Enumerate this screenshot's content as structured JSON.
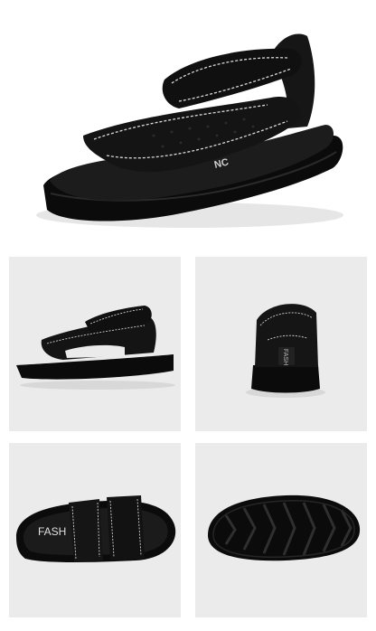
{
  "gallery": {
    "hero": {
      "view": "three-quarter-front",
      "logo_text": "NC"
    },
    "tiles": [
      {
        "view": "side"
      },
      {
        "view": "back",
        "heel_text": "FASH"
      },
      {
        "view": "top",
        "insole_text": "FASH"
      },
      {
        "view": "sole"
      }
    ]
  },
  "colors": {
    "background": "#ffffff",
    "tile_background": "#ebebeb",
    "leather": "#141414",
    "stitching": "#d9d9d9",
    "sole": "#0b0b0b"
  }
}
